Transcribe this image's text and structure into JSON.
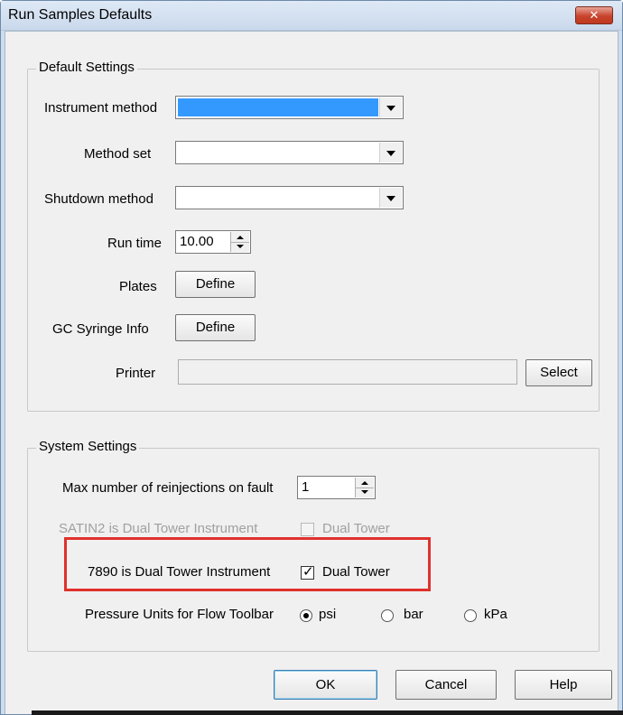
{
  "window": {
    "title": "Run Samples Defaults",
    "close_glyph": "✕"
  },
  "default_settings": {
    "legend": "Default Settings",
    "instrument_method_label": "Instrument method",
    "instrument_method_value": "",
    "method_set_label": "Method set",
    "method_set_value": "",
    "shutdown_method_label": "Shutdown method",
    "shutdown_method_value": "",
    "run_time_label": "Run time",
    "run_time_value": "10.00",
    "plates_label": "Plates",
    "plates_button": "Define",
    "gc_syringe_label": "GC Syringe Info",
    "gc_syringe_button": "Define",
    "printer_label": "Printer",
    "printer_value": "",
    "printer_button": "Select"
  },
  "system_settings": {
    "legend": "System Settings",
    "max_reinjections_label": "Max number of reinjections on fault",
    "max_reinjections_value": "1",
    "satin2_label": "SATIN2 is Dual Tower Instrument",
    "satin2_checkbox_label": "Dual Tower",
    "satin2_checked": false,
    "dual7890_label": "7890 is Dual Tower Instrument",
    "dual7890_checkbox_label": "Dual Tower",
    "dual7890_checked": true,
    "pressure_label": "Pressure Units for Flow Toolbar",
    "pressure_options": [
      "psi",
      "bar",
      "kPa"
    ],
    "pressure_selected": "psi"
  },
  "buttons": {
    "ok": "OK",
    "cancel": "Cancel",
    "help": "Help"
  },
  "colors": {
    "highlight_red": "#e0312d",
    "selection_blue": "#3399ff"
  }
}
